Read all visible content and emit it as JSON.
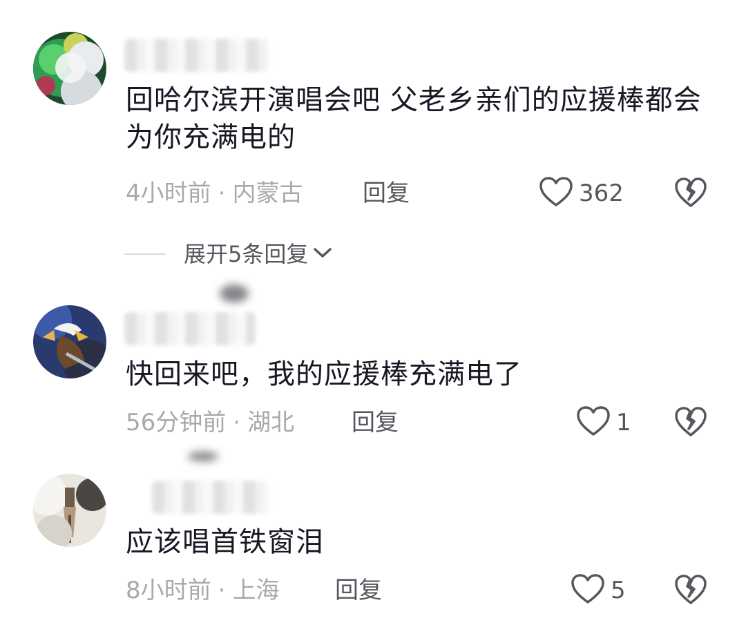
{
  "comments": [
    {
      "username": "",
      "text": "回哈尔滨开演唱会吧 父老乡亲们的应援棒都会为你充满电的",
      "time": "4小时前",
      "location": "内蒙古",
      "reply_label": "回复",
      "like_count": "362",
      "expand_replies": "展开5条回复"
    },
    {
      "username": "",
      "text": "快回来吧，我的应援棒充满电了",
      "time": "56分钟前",
      "location": "湖北",
      "reply_label": "回复",
      "like_count": "1"
    },
    {
      "username": "",
      "text": "应该唱首铁窗泪",
      "time": "8小时前",
      "location": "上海",
      "reply_label": "回复",
      "like_count": "5"
    }
  ],
  "meta_separator": "·",
  "icons": {
    "like": "heart-outline-icon",
    "dislike": "broken-heart-icon",
    "expand": "chevron-down-icon"
  },
  "colors": {
    "text_primary": "#161823",
    "text_secondary": "#a8a9ad",
    "action_text": "#55575e",
    "icon_stroke": "#55575e"
  }
}
